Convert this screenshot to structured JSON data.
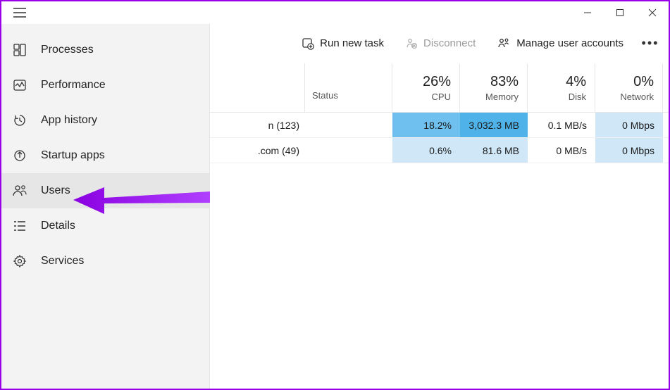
{
  "window_controls": {
    "minimize_tooltip": "Minimize",
    "maximize_tooltip": "Maximize",
    "close_tooltip": "Close"
  },
  "sidebar": {
    "items": [
      {
        "label": "Processes",
        "icon": "processes"
      },
      {
        "label": "Performance",
        "icon": "performance"
      },
      {
        "label": "App history",
        "icon": "app-history"
      },
      {
        "label": "Startup apps",
        "icon": "startup-apps"
      },
      {
        "label": "Users",
        "icon": "users",
        "selected": true
      },
      {
        "label": "Details",
        "icon": "details"
      },
      {
        "label": "Services",
        "icon": "services"
      }
    ]
  },
  "toolbar": {
    "run_new_task": "Run new task",
    "disconnect": "Disconnect",
    "manage_user_accounts": "Manage user accounts"
  },
  "columns": {
    "status": "Status",
    "cpu": {
      "pct": "26%",
      "label": "CPU"
    },
    "memory": {
      "pct": "83%",
      "label": "Memory"
    },
    "disk": {
      "pct": "4%",
      "label": "Disk"
    },
    "network": {
      "pct": "0%",
      "label": "Network"
    }
  },
  "rows": [
    {
      "name_suffix": "n (123)",
      "cpu": "18.2%",
      "memory": "3,032.3 MB",
      "disk": "0.1 MB/s",
      "network": "0 Mbps",
      "heat": {
        "cpu": "heat-high",
        "memory": "heat-vhigh",
        "disk": "",
        "network": "heat-light"
      }
    },
    {
      "name_suffix": ".com (49)",
      "cpu": "0.6%",
      "memory": "81.6 MB",
      "disk": "0 MB/s",
      "network": "0 Mbps",
      "heat": {
        "cpu": "heat-light",
        "memory": "heat-light",
        "disk": "",
        "network": "heat-light"
      }
    }
  ]
}
